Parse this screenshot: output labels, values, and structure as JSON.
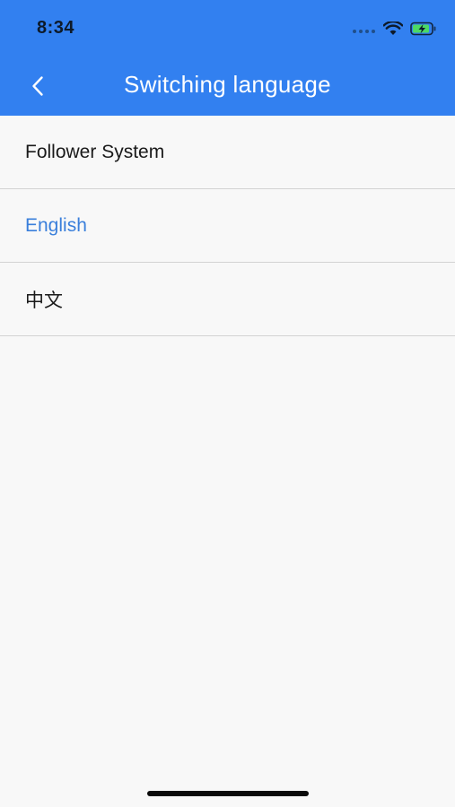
{
  "status_bar": {
    "time": "8:34",
    "icons": [
      "signal-dots-icon",
      "wifi-icon",
      "battery-charging-icon"
    ]
  },
  "nav": {
    "title": "Switching language",
    "back_icon": "chevron-left-icon"
  },
  "list": {
    "items": [
      {
        "label": "Follower System",
        "selected": false
      },
      {
        "label": "English",
        "selected": true
      },
      {
        "label": "中文",
        "selected": false
      }
    ]
  },
  "colors": {
    "header_background": "#3280f0",
    "selected_text": "#3a7fdb",
    "background": "#f8f8f8",
    "divider": "#d3d3d3"
  }
}
